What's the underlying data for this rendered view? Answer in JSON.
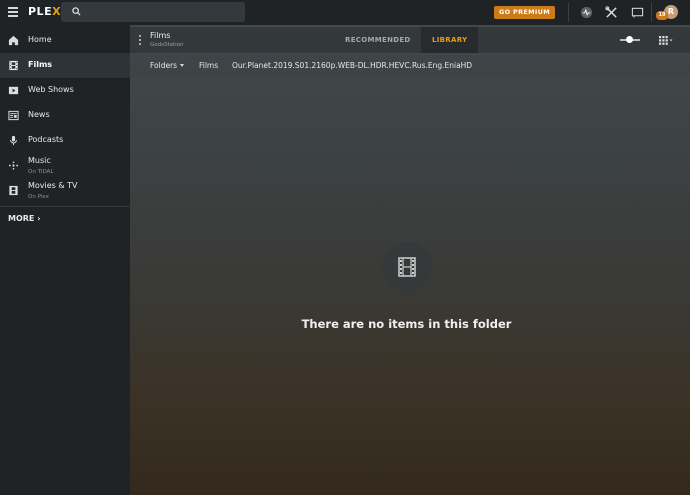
{
  "app": {
    "logo_text": "PLEX",
    "logo_accent_letter": "X",
    "accent_color": "#e5a00d"
  },
  "topbar": {
    "search_placeholder": "",
    "premium_label": "GO PREMIUM",
    "notification_count": "19",
    "avatar_initial": "R"
  },
  "sidebar": {
    "items": [
      {
        "label": "Home",
        "sub": "",
        "icon": "home-icon",
        "active": false
      },
      {
        "label": "Films",
        "sub": "",
        "icon": "film-icon",
        "active": true
      },
      {
        "label": "Web Shows",
        "sub": "",
        "icon": "tv-play-icon",
        "active": false
      },
      {
        "label": "News",
        "sub": "",
        "icon": "news-icon",
        "active": false
      },
      {
        "label": "Podcasts",
        "sub": "",
        "icon": "microphone-icon",
        "active": false
      },
      {
        "label": "Music",
        "sub": "On TIDAL",
        "icon": "music-icon",
        "active": false
      },
      {
        "label": "Movies & TV",
        "sub": "On Plex",
        "icon": "film-icon",
        "active": false
      }
    ],
    "more_label": "MORE"
  },
  "library": {
    "title": "Films",
    "server": "GodsStation",
    "tabs": [
      {
        "label": "RECOMMENDED",
        "active": false
      },
      {
        "label": "LIBRARY",
        "active": true
      }
    ]
  },
  "breadcrumb": {
    "folders_label": "Folders",
    "parent": "Films",
    "current": "Our.Planet.2019.S01.2160p.WEB-DL.HDR.HEVC.Rus.Eng.EniaHD"
  },
  "empty_state": {
    "icon": "film-icon",
    "message": "There are no items in this folder"
  }
}
